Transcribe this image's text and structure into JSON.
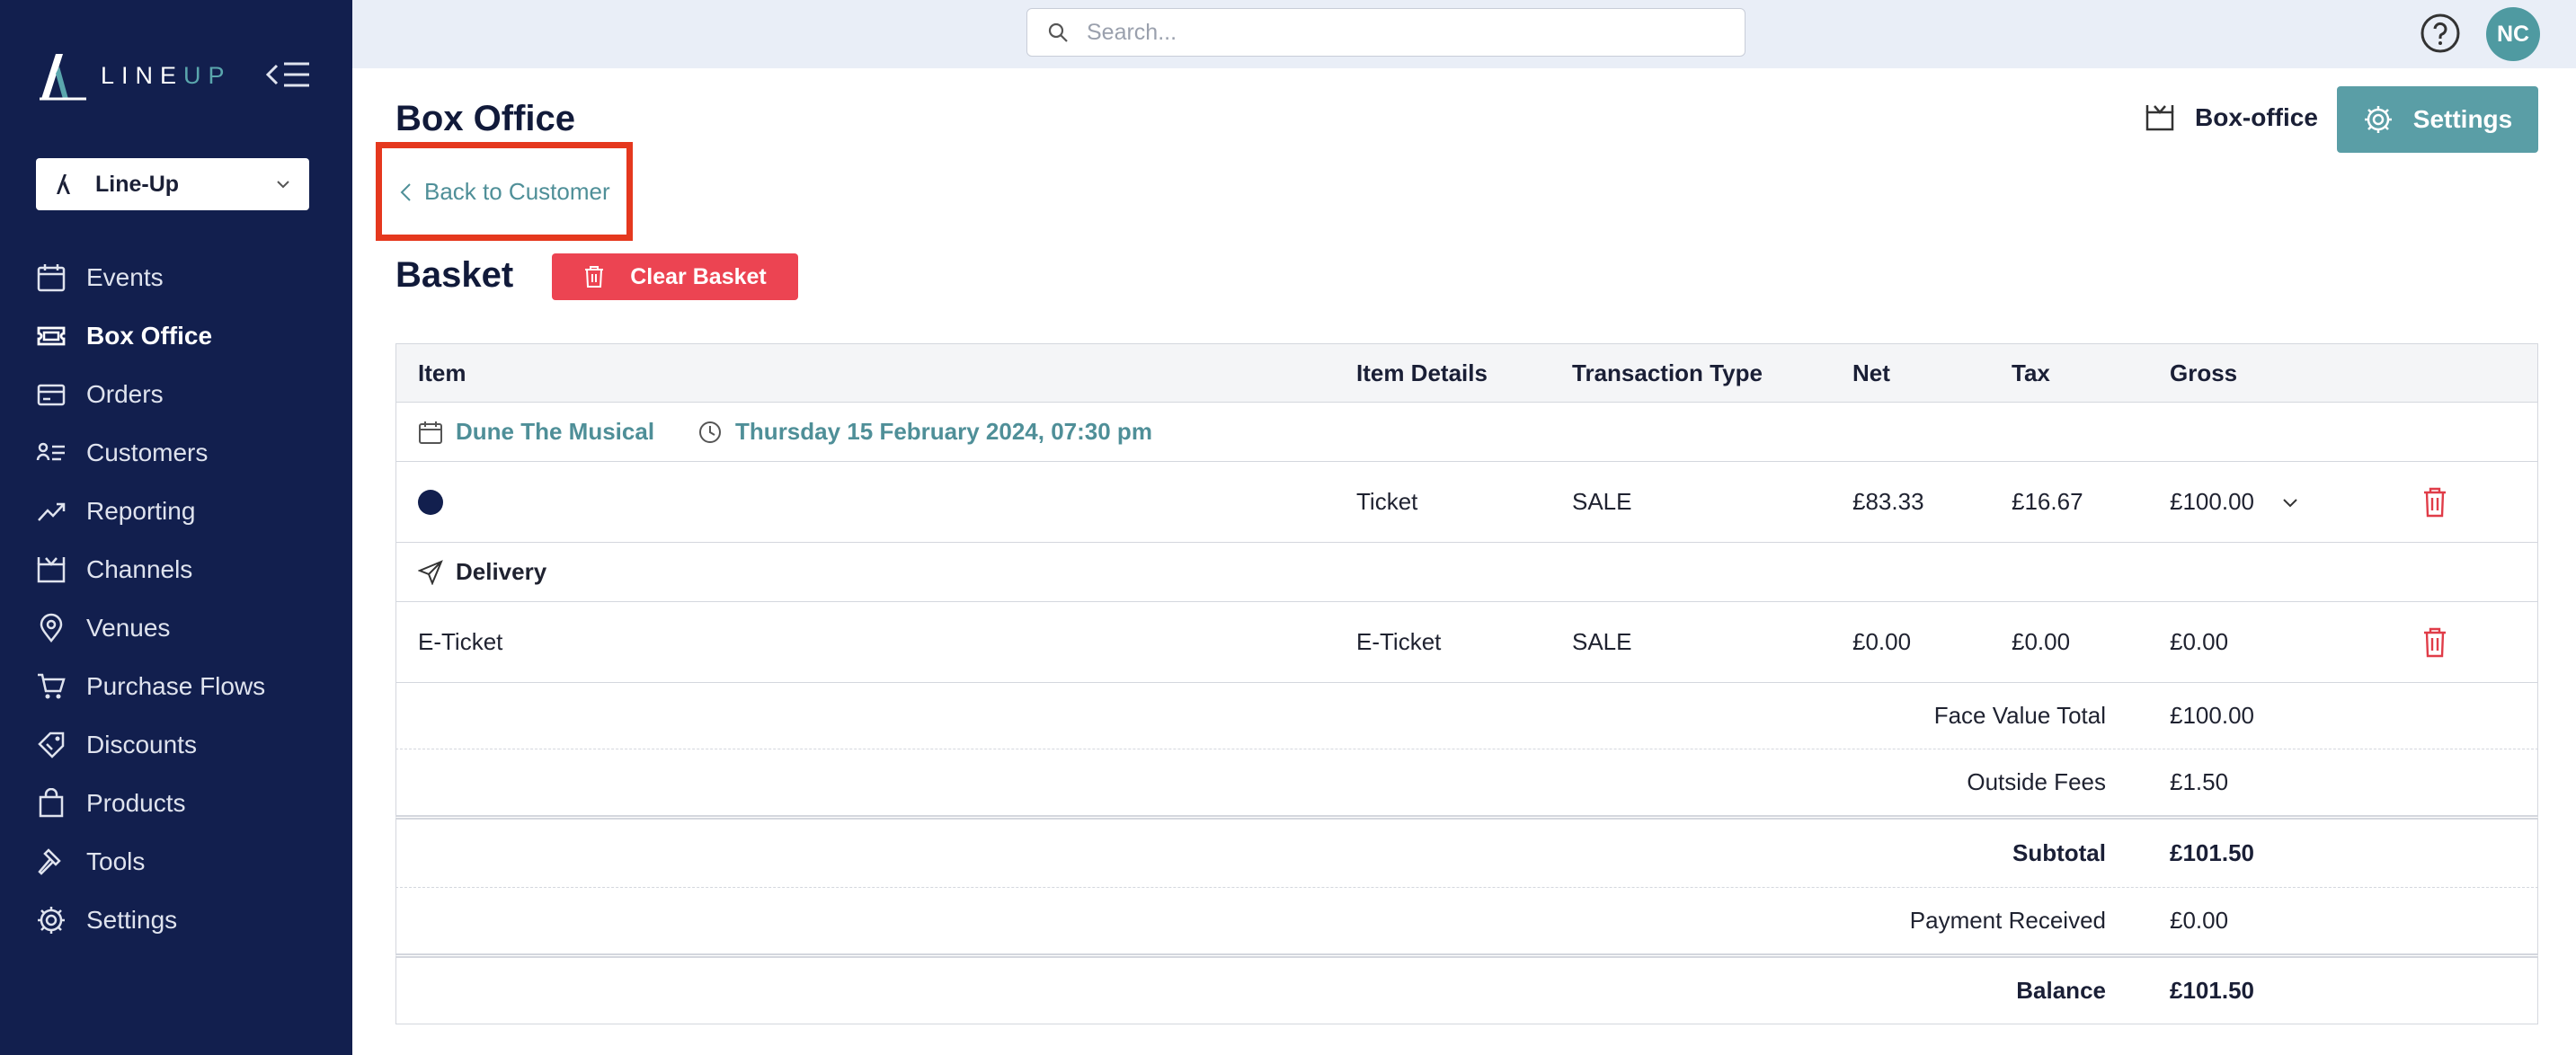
{
  "sidebar": {
    "logo_line": "LINE",
    "logo_up": "UP",
    "org_select": "Line-Up",
    "items": [
      {
        "label": "Events",
        "icon": "calendar-icon"
      },
      {
        "label": "Box Office",
        "icon": "ticket-icon",
        "active": true
      },
      {
        "label": "Orders",
        "icon": "credit-card-icon"
      },
      {
        "label": "Customers",
        "icon": "customers-icon"
      },
      {
        "label": "Reporting",
        "icon": "trending-up-icon"
      },
      {
        "label": "Channels",
        "icon": "tv-icon"
      },
      {
        "label": "Venues",
        "icon": "map-pin-icon"
      },
      {
        "label": "Purchase Flows",
        "icon": "cart-icon"
      },
      {
        "label": "Discounts",
        "icon": "tag-icon"
      },
      {
        "label": "Products",
        "icon": "shopping-bag-icon"
      },
      {
        "label": "Tools",
        "icon": "hammer-icon"
      },
      {
        "label": "Settings",
        "icon": "gear-icon"
      }
    ]
  },
  "topbar": {
    "search_placeholder": "Search...",
    "avatar_initials": "NC"
  },
  "header": {
    "title": "Box Office",
    "boxoffice_link": "Box-office",
    "settings_button": "Settings",
    "back_link": "Back to Customer"
  },
  "basket": {
    "title": "Basket",
    "clear_button": "Clear Basket",
    "columns": {
      "item": "Item",
      "details": "Item Details",
      "type": "Transaction Type",
      "net": "Net",
      "tax": "Tax",
      "gross": "Gross"
    },
    "event": {
      "name": "Dune The Musical",
      "datetime": "Thursday 15 February 2024, 07:30 pm"
    },
    "ticket": {
      "details": "Ticket",
      "type": "SALE",
      "net": "£83.33",
      "tax": "£16.67",
      "gross": "£100.00"
    },
    "delivery_label": "Delivery",
    "delivery": {
      "item": "E-Ticket",
      "details": "E-Ticket",
      "type": "SALE",
      "net": "£0.00",
      "tax": "£0.00",
      "gross": "£0.00"
    },
    "summary": {
      "face_value_label": "Face Value Total",
      "face_value": "£100.00",
      "outside_fees_label": "Outside Fees",
      "outside_fees": "£1.50",
      "subtotal_label": "Subtotal",
      "subtotal": "£101.50",
      "payment_label": "Payment Received",
      "payment": "£0.00",
      "balance_label": "Balance",
      "balance": "£101.50"
    }
  },
  "colors": {
    "sidebar_bg": "#121f4e",
    "accent": "#5a9ea6",
    "danger": "#ec4452",
    "highlight": "#e5381e"
  }
}
